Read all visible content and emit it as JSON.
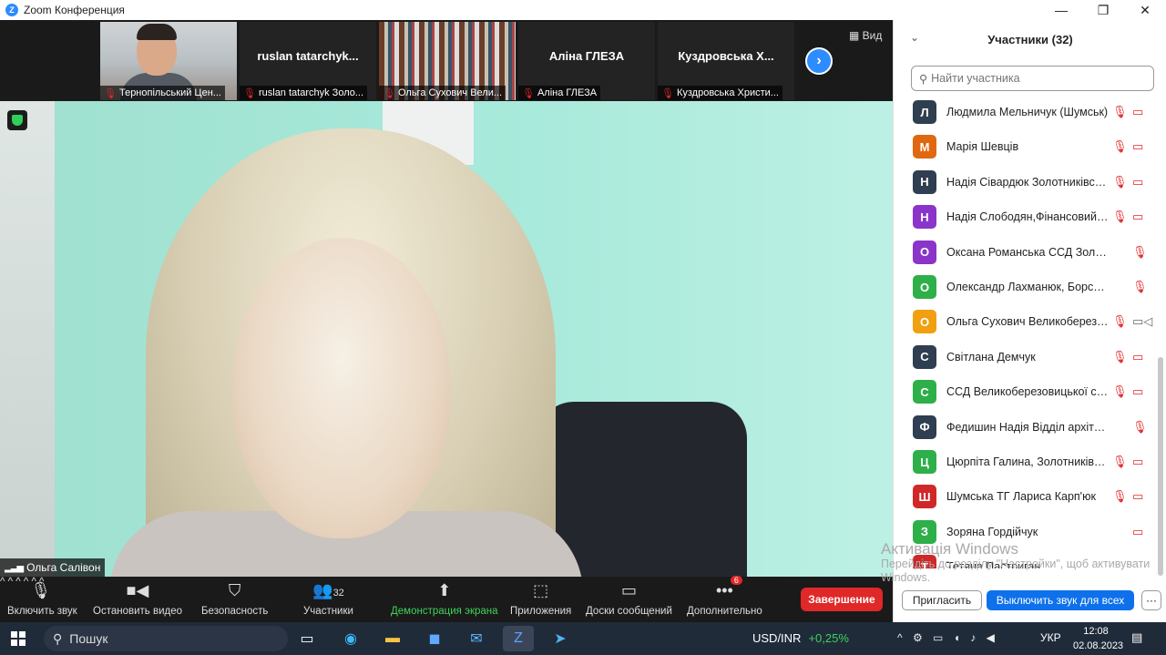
{
  "window": {
    "title": "Zoom Конференция",
    "minimize": "—",
    "restore": "❐",
    "close": "✕"
  },
  "strip": {
    "thumbs": [
      {
        "name": "",
        "label": "Тернопільський Цен..."
      },
      {
        "name": "ruslan  tatarchyk...",
        "label": "ruslan tatarchyk Золо..."
      },
      {
        "name": "",
        "label": "Ольга Сухович Вели..."
      },
      {
        "name": "Аліна ГЛЕЗА",
        "label": "Аліна ГЛЕЗА"
      },
      {
        "name": "Куздровська  Х...",
        "label": "Куздровська Христи..."
      }
    ],
    "view_label": "Вид"
  },
  "main": {
    "speaker": "Ольга Салівон"
  },
  "toolbar": {
    "unmute": "Включить звук",
    "stop_video": "Остановить видео",
    "security": "Безопасность",
    "participants": "Участники",
    "participants_count": "32",
    "share": "Демонстрация экрана",
    "apps": "Приложения",
    "whiteboards": "Доски сообщений",
    "more": "Дополнительно",
    "more_badge": "6",
    "end": "Завершение"
  },
  "panel": {
    "title": "Участники (32)",
    "search_placeholder": "Найти участника",
    "participants": [
      {
        "initial": "Л",
        "name": "Людмила Мельничук (Шумськ)",
        "color": "#2f3e50",
        "video": "off"
      },
      {
        "initial": "М",
        "name": "Марія Шевців",
        "color": "#e06810",
        "video": "off"
      },
      {
        "initial": "Н",
        "name": "Надія Сівардюк Золотниківськ...",
        "color": "#2f3e50",
        "video": "off"
      },
      {
        "initial": "Н",
        "name": "Надія Слободян,Фінансовий ві...",
        "color": "#8a34c9",
        "video": "off"
      },
      {
        "initial": "О",
        "name": "Оксана Романська ССД Золотникі...",
        "color": "#8a34c9",
        "video": "none"
      },
      {
        "initial": "О",
        "name": "Олександр Лахманюк, Борсуківсь...",
        "color": "#2eaf4a",
        "video": "none"
      },
      {
        "initial": "О",
        "name": "Ольга Сухович Великоберезо...",
        "color": "#f0a010",
        "video": "on"
      },
      {
        "initial": "С",
        "name": "Світлана Демчук",
        "color": "#2f3e50",
        "video": "off"
      },
      {
        "initial": "С",
        "name": "ССД Великоберезовицької се...",
        "color": "#2eaf4a",
        "video": "off"
      },
      {
        "initial": "Ф",
        "name": "Федишин Надія Відділ архітектури,...",
        "color": "#2f3e50",
        "video": "none"
      },
      {
        "initial": "Ц",
        "name": "Цюрпіта Галина, Золотниківсь...",
        "color": "#2eaf4a",
        "video": "off"
      },
      {
        "initial": "Ш",
        "name": "Шумська ТГ Лариса Карп'юк",
        "color": "#d02828",
        "video": "off"
      },
      {
        "initial": "З",
        "name": "Зоряна Гордійчук",
        "color": "#2eaf4a",
        "video": "offonly"
      },
      {
        "initial": "Т",
        "name": "Тетяна Пастриган",
        "color": "#d02828",
        "video": "hidden"
      }
    ],
    "watermark_title": "Активація Windows",
    "watermark_sub": "Перейдіть до розділу \"Настройки\", щоб активувати Windows.",
    "invite": "Пригласить",
    "mute_all": "Выключить звук для всех",
    "more": "···"
  },
  "taskbar": {
    "search": "Пошук",
    "ticker_symbol": "USD/INR",
    "ticker_change": "+0,25%",
    "lang": "УКР",
    "time": "12:08",
    "date": "02.08.2023"
  }
}
